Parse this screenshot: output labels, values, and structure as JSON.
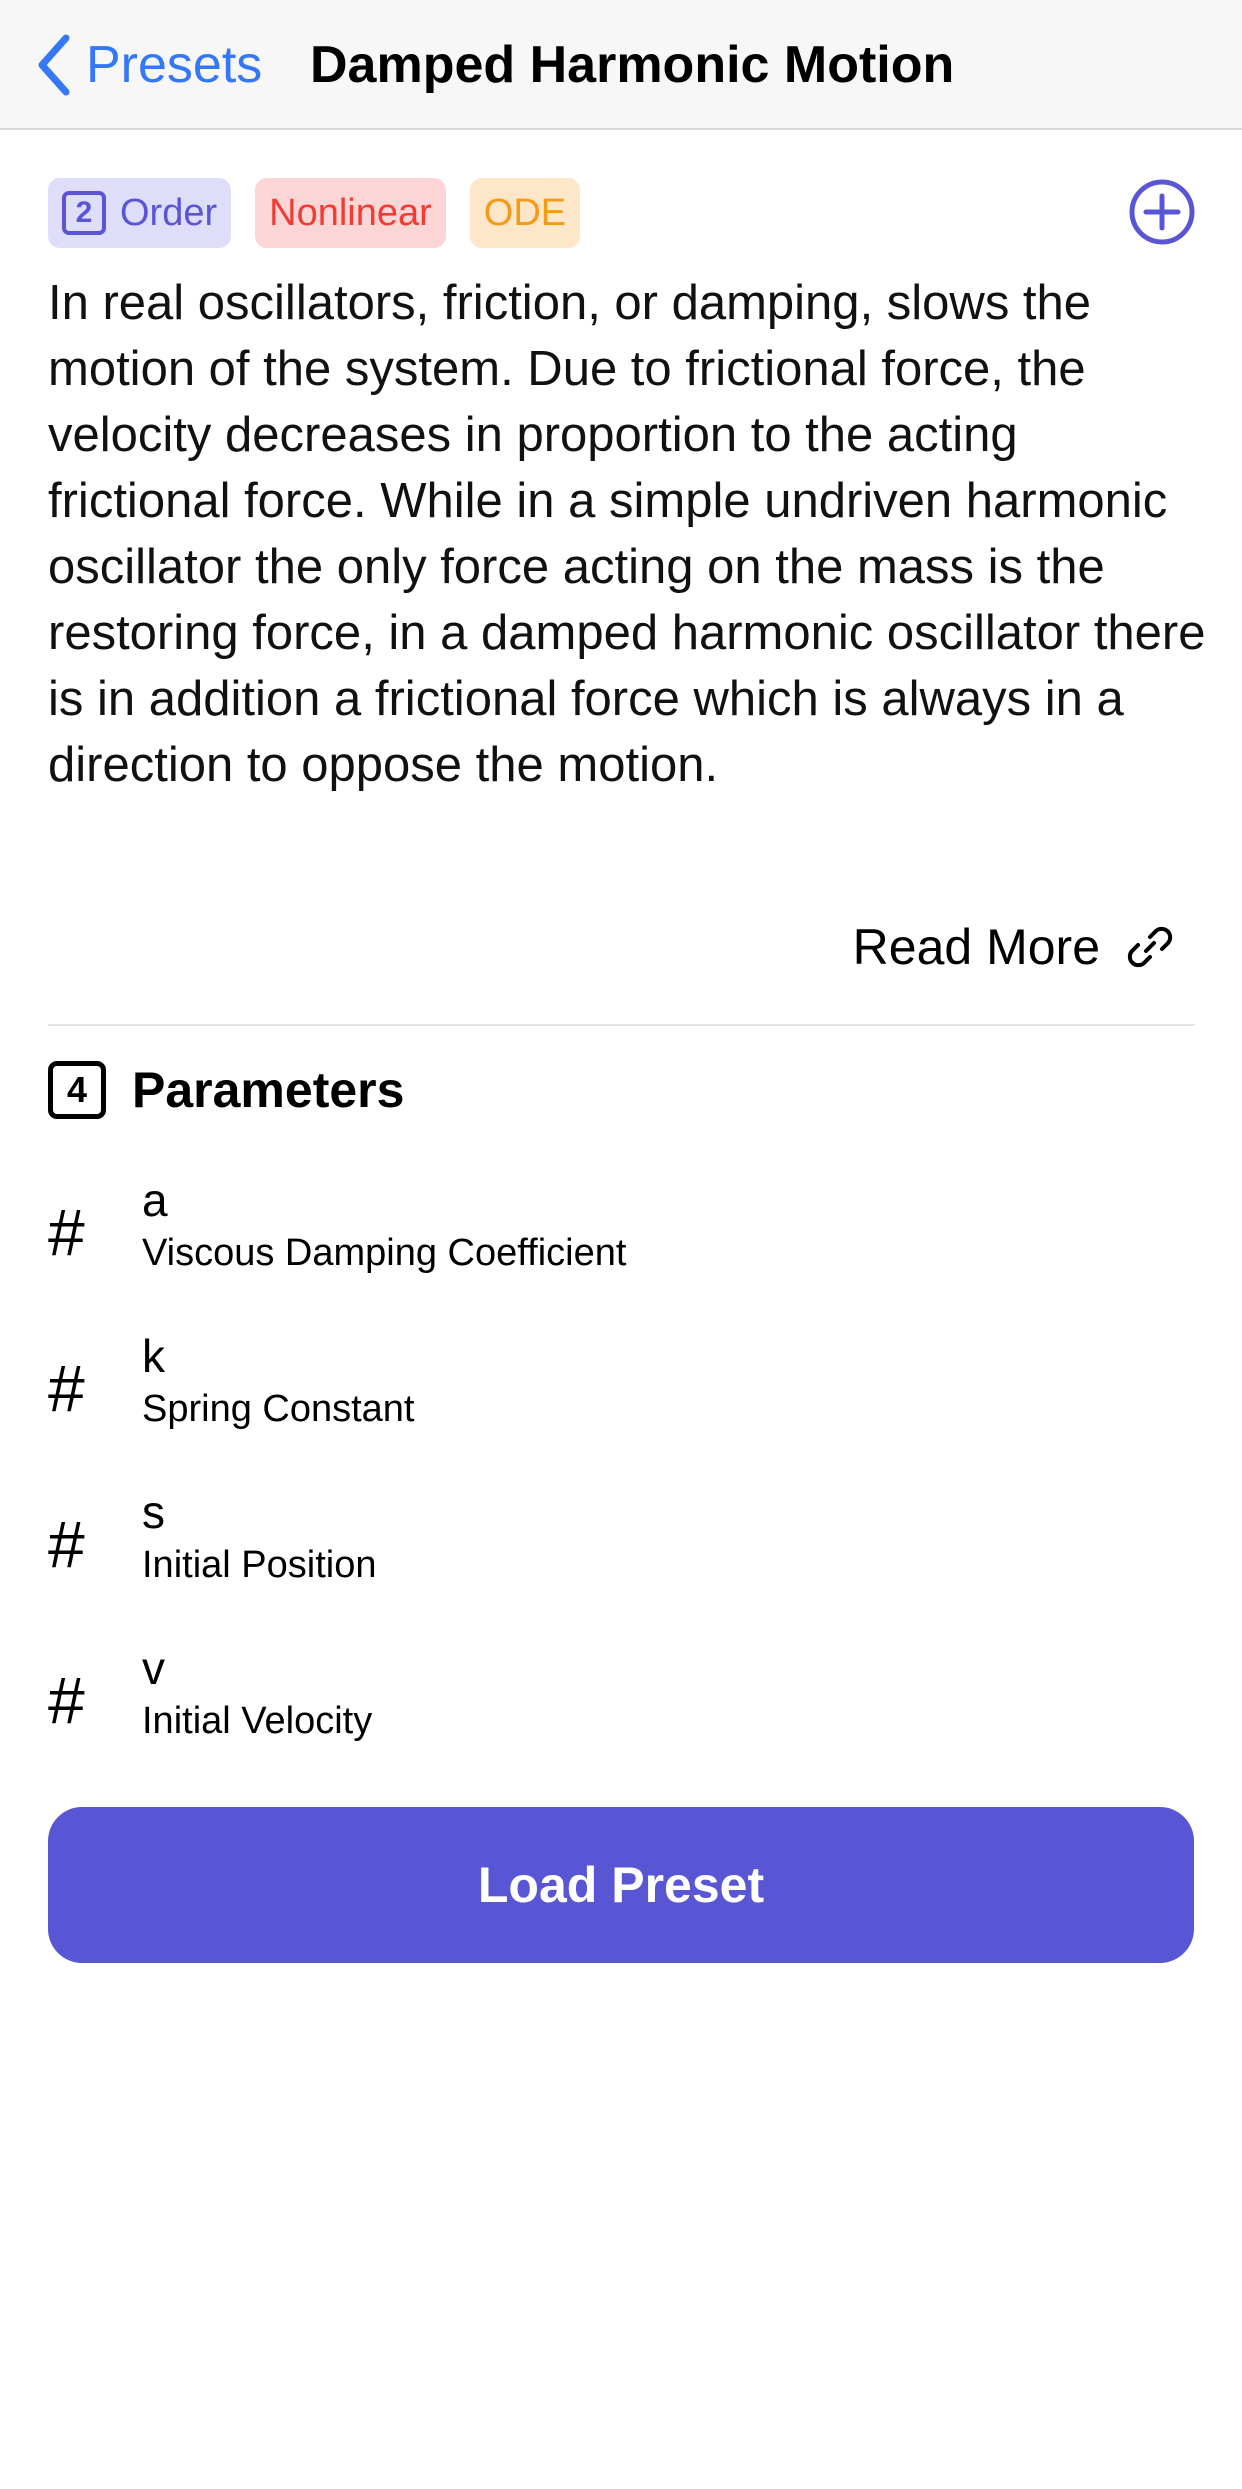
{
  "navbar": {
    "back_label": "Presets",
    "title": "Damped Harmonic Motion"
  },
  "tags": {
    "order_number": "2",
    "order_label": "Order",
    "nonlinear_label": "Nonlinear",
    "ode_label": "ODE"
  },
  "description": "In real oscillators, friction, or damping, slows the motion of the system. Due to frictional force, the velocity decreases in proportion to the acting frictional force. While in a simple undriven harmonic oscillator the only force acting on the mass is the restoring force, in a damped harmonic oscillator there is in addition a frictional force which is always in a direction to oppose the motion.",
  "read_more_label": "Read More",
  "parameters": {
    "count": "4",
    "title": "Parameters",
    "items": [
      {
        "symbol": "a",
        "description": "Viscous Damping Coefficient"
      },
      {
        "symbol": "k",
        "description": "Spring Constant"
      },
      {
        "symbol": "s",
        "description": "Initial Position"
      },
      {
        "symbol": "v",
        "description": "Initial Velocity"
      }
    ]
  },
  "load_button_label": "Load Preset",
  "icons": {
    "back": "chevron-left-icon",
    "add": "plus-circle-icon",
    "link": "link-icon",
    "param": "hash-icon"
  },
  "colors": {
    "accent": "#5956d6",
    "back_blue": "#3478f6",
    "nonlinear_red": "#f23b31",
    "ode_orange": "#f49a18"
  }
}
